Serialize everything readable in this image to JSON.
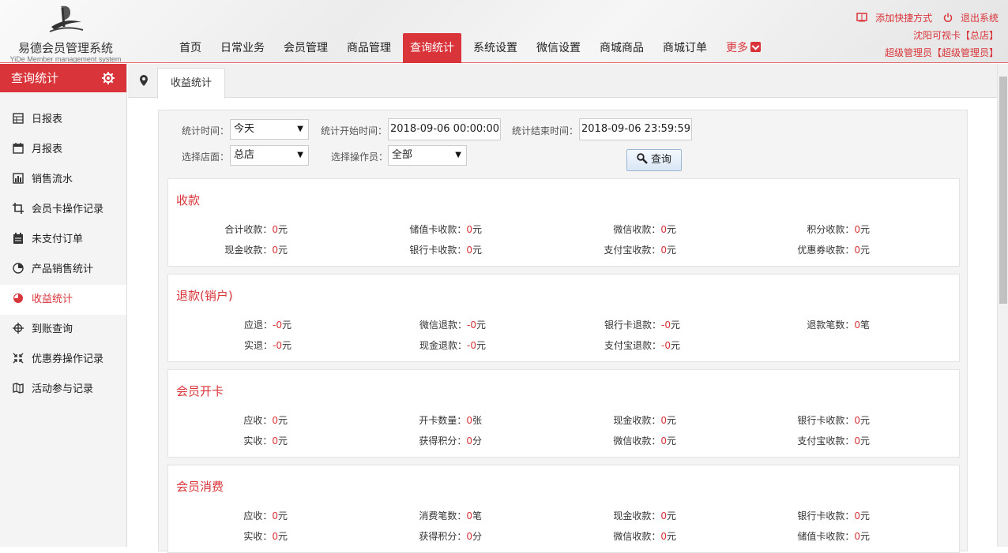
{
  "app": {
    "name": "易德会员管理系统",
    "subtitle": "YiDe Member management system"
  },
  "nav": [
    {
      "label": "首页",
      "active": false
    },
    {
      "label": "日常业务",
      "active": false
    },
    {
      "label": "会员管理",
      "active": false
    },
    {
      "label": "商品管理",
      "active": false
    },
    {
      "label": "查询统计",
      "active": true
    },
    {
      "label": "系统设置",
      "active": false
    },
    {
      "label": "微信设置",
      "active": false
    },
    {
      "label": "商城商品",
      "active": false
    },
    {
      "label": "商城订单",
      "active": false
    }
  ],
  "nav_more": "更多",
  "topright": {
    "add_shortcut": "添加快捷方式",
    "logout": "退出系统",
    "store": "沈阳可视卡【总店】",
    "user": "超级管理员【超级管理员】"
  },
  "sidebar": {
    "title": "查询统计",
    "items": [
      {
        "label": "日报表",
        "icon": "table-icon"
      },
      {
        "label": "月报表",
        "icon": "calendar-icon"
      },
      {
        "label": "销售流水",
        "icon": "bar-chart-icon"
      },
      {
        "label": "会员卡操作记录",
        "icon": "crop-icon"
      },
      {
        "label": "未支付订单",
        "icon": "clipboard-icon"
      },
      {
        "label": "产品销售统计",
        "icon": "pie-icon"
      },
      {
        "label": "收益统计",
        "icon": "pie-filled-icon",
        "active": true
      },
      {
        "label": "到账查询",
        "icon": "crosshair-icon"
      },
      {
        "label": "优惠券操作记录",
        "icon": "compress-icon"
      },
      {
        "label": "活动参与记录",
        "icon": "map-icon"
      }
    ]
  },
  "tab": {
    "label": "收益统计"
  },
  "filters": {
    "time_label": "统计时间：",
    "time_value": "今天",
    "start_label": "统计开始时间：",
    "start_value": "2018-09-06 00:00:00",
    "end_label": "统计结束时间：",
    "end_value": "2018-09-06 23:59:59",
    "store_label": "选择店面：",
    "store_value": "总店",
    "operator_label": "选择操作员：",
    "operator_value": "全部",
    "query_button": "查询"
  },
  "panels": [
    {
      "title": "收款",
      "rows": [
        [
          {
            "k": "合计收款：",
            "v": "0",
            "u": "元"
          },
          {
            "k": "储值卡收款：",
            "v": "0",
            "u": "元"
          },
          {
            "k": "微信收款：",
            "v": "0",
            "u": "元"
          },
          {
            "k": "积分收款：",
            "v": "0",
            "u": "元"
          }
        ],
        [
          {
            "k": "现金收款：",
            "v": "0",
            "u": "元"
          },
          {
            "k": "银行卡收款：",
            "v": "0",
            "u": "元"
          },
          {
            "k": "支付宝收款：",
            "v": "0",
            "u": "元"
          },
          {
            "k": "优惠券收款：",
            "v": "0",
            "u": "元"
          }
        ]
      ]
    },
    {
      "title": "退款(销户)",
      "rows": [
        [
          {
            "k": "应退：",
            "v": "-0",
            "u": "元"
          },
          {
            "k": "微信退款：",
            "v": "-0",
            "u": "元"
          },
          {
            "k": "银行卡退款：",
            "v": "-0",
            "u": "元"
          },
          {
            "k": "退款笔数：",
            "v": "0",
            "u": "笔"
          }
        ],
        [
          {
            "k": "实退：",
            "v": "-0",
            "u": "元"
          },
          {
            "k": "现金退款：",
            "v": "-0",
            "u": "元"
          },
          {
            "k": "支付宝退款：",
            "v": "-0",
            "u": "元"
          }
        ]
      ]
    },
    {
      "title": "会员开卡",
      "rows": [
        [
          {
            "k": "应收：",
            "v": "0",
            "u": "元"
          },
          {
            "k": "开卡数量：",
            "v": "0",
            "u": "张"
          },
          {
            "k": "现金收款：",
            "v": "0",
            "u": "元"
          },
          {
            "k": "银行卡收款：",
            "v": "0",
            "u": "元"
          }
        ],
        [
          {
            "k": "实收：",
            "v": "0",
            "u": "元"
          },
          {
            "k": "获得积分：",
            "v": "0",
            "u": "分"
          },
          {
            "k": "微信收款：",
            "v": "0",
            "u": "元"
          },
          {
            "k": "支付宝收款：",
            "v": "0",
            "u": "元"
          }
        ]
      ]
    },
    {
      "title": "会员消费",
      "rows": [
        [
          {
            "k": "应收：",
            "v": "0",
            "u": "元"
          },
          {
            "k": "消费笔数：",
            "v": "0",
            "u": "笔"
          },
          {
            "k": "现金收款：",
            "v": "0",
            "u": "元"
          },
          {
            "k": "银行卡收款：",
            "v": "0",
            "u": "元"
          }
        ],
        [
          {
            "k": "实收：",
            "v": "0",
            "u": "元"
          },
          {
            "k": "获得积分：",
            "v": "0",
            "u": "分"
          },
          {
            "k": "微信收款：",
            "v": "0",
            "u": "元"
          },
          {
            "k": "储值卡收款：",
            "v": "0",
            "u": "元"
          }
        ]
      ]
    }
  ],
  "colors": {
    "accent": "#d9343a",
    "sidebar_bg": "#f4f4f4"
  }
}
